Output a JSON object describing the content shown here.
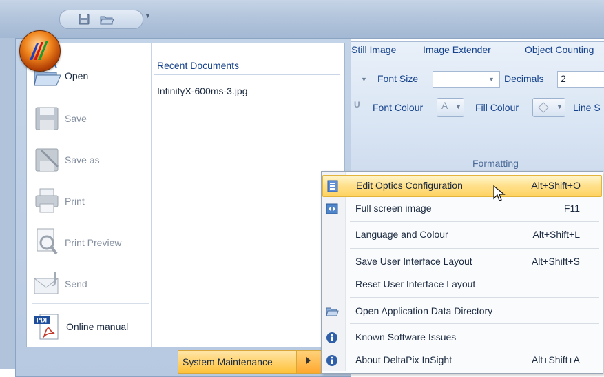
{
  "quick_access": {
    "icons": [
      "save-icon",
      "open-folder-icon",
      "customize-dropdown-icon"
    ]
  },
  "ribbon": {
    "tabs": [
      "Still Image",
      "Image Extender",
      "Object Counting"
    ],
    "font_size_label": "Font Size",
    "decimals_label": "Decimals",
    "decimals_value": "2",
    "font_colour_label": "Font Colour",
    "fill_colour_label": "Fill Colour",
    "line_label": "Line S",
    "group_label": "Formatting"
  },
  "office_menu": {
    "items": [
      {
        "label": "Open",
        "icon": "open-folder-icon",
        "enabled": true
      },
      {
        "label": "Save",
        "icon": "save-icon",
        "enabled": false
      },
      {
        "label": "Save as",
        "icon": "save-as-icon",
        "enabled": false
      },
      {
        "label": "Print",
        "icon": "printer-icon",
        "enabled": false
      },
      {
        "label": "Print Preview",
        "icon": "print-preview-icon",
        "enabled": false
      },
      {
        "label": "Send",
        "icon": "envelope-icon",
        "enabled": false
      },
      {
        "label": "Online manual",
        "icon": "pdf-icon",
        "enabled": true
      }
    ],
    "recent_header": "Recent Documents",
    "recent_items": [
      "InfinityX-600ms-3.jpg"
    ],
    "system_maintenance_label": "System Maintenance"
  },
  "submenu": {
    "items": [
      {
        "label": "Edit Optics Configuration",
        "shortcut": "Alt+Shift+O",
        "icon": "optics-config-icon",
        "highlighted": true
      },
      {
        "label": "Full screen image",
        "shortcut": "F11",
        "icon": "fullscreen-icon"
      },
      {
        "label": "Language and Colour",
        "shortcut": "Alt+Shift+L",
        "icon": ""
      },
      {
        "label": "Save User Interface Layout",
        "shortcut": "Alt+Shift+S",
        "icon": ""
      },
      {
        "label": "Reset User Interface Layout",
        "shortcut": "",
        "icon": ""
      },
      {
        "label": "Open Application Data Directory",
        "shortcut": "",
        "icon": "folder-icon"
      },
      {
        "label": "Known Software Issues",
        "shortcut": "",
        "icon": "info-icon"
      },
      {
        "label": "About DeltaPix InSight",
        "shortcut": "Alt+Shift+A",
        "icon": "info-icon"
      }
    ]
  },
  "colors": {
    "highlight": "#ffd260",
    "ribbon_text": "#15428b",
    "frame_blue": "#b3c5dc"
  }
}
